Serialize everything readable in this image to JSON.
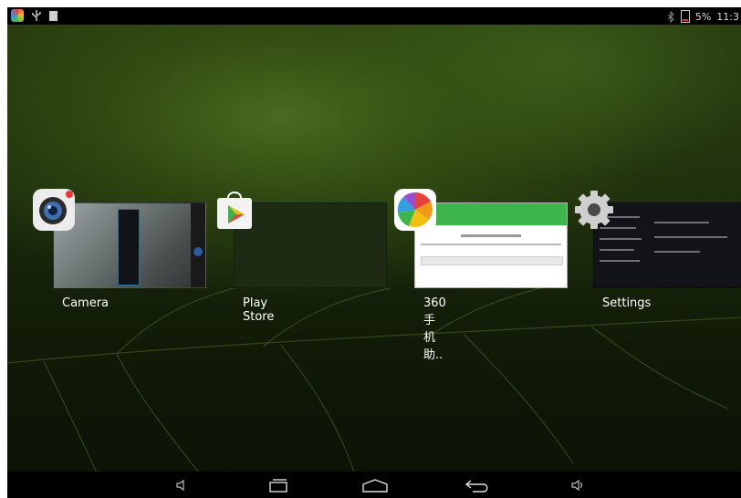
{
  "status_bar": {
    "left_icons": [
      "app-360-icon",
      "usb-icon",
      "notification-square-icon"
    ],
    "battery_text": "5%",
    "time": "11:3",
    "right_icons": [
      "bluetooth-icon",
      "battery-icon"
    ]
  },
  "recent_apps": [
    {
      "label": "Camera",
      "icon": "camera-icon"
    },
    {
      "label": "Play Store",
      "icon": "play-store-icon"
    },
    {
      "label": "360手机助..",
      "icon": "app-360-icon"
    },
    {
      "label": "Settings",
      "icon": "gear-icon"
    }
  ],
  "navigation_bar": {
    "buttons": [
      "volume-down-icon",
      "recent-apps-icon",
      "home-icon",
      "back-icon",
      "volume-up-icon"
    ]
  }
}
